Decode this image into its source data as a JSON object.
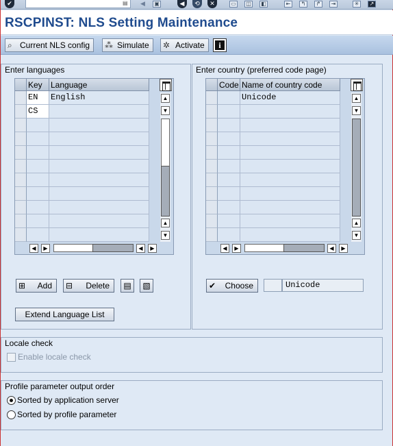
{
  "window": {
    "title": "RSCPINST: NLS Setting Maintenance"
  },
  "system_toolbar": {
    "command_field": {
      "value": "",
      "placeholder": ""
    },
    "icons": [
      "enter-icon",
      "save-icon",
      "back-icon",
      "exit-icon",
      "cancel-icon",
      "print-icon",
      "find-icon",
      "find-next-icon",
      "first-page-icon",
      "prev-page-icon",
      "next-page-icon",
      "last-page-icon",
      "create-session-icon",
      "shortcut-icon"
    ]
  },
  "app_toolbar": {
    "current_nls_config": "Current NLS config",
    "simulate": "Simulate",
    "activate": "Activate",
    "info_icon": "info-icon"
  },
  "languages": {
    "group_title": "Enter languages",
    "columns": [
      "Key",
      "Language"
    ],
    "rows": [
      {
        "key": "EN",
        "language": "English"
      },
      {
        "key": "CS",
        "language": ""
      }
    ],
    "add_label": "Add",
    "delete_label": "Delete",
    "extend_label": "Extend Language List"
  },
  "country": {
    "group_title": "Enter country (preferred code page)",
    "columns": [
      "Code",
      "Name of country code"
    ],
    "rows": [
      {
        "code": "",
        "name": "Unicode"
      }
    ],
    "choose_label": "Choose",
    "selected_code": "",
    "selected_name": "Unicode"
  },
  "locale_check": {
    "group_title": "Locale check",
    "enable_label": "Enable locale check",
    "enabled": false
  },
  "profile_output": {
    "group_title": "Profile parameter output order",
    "options": [
      {
        "label": "Sorted by application server",
        "selected": true
      },
      {
        "label": "Sorted by profile parameter",
        "selected": false
      }
    ]
  },
  "colors": {
    "title_blue": "#1f4b8e",
    "panel_bg": "#dfe9f5",
    "table_bg": "#dbe6f3"
  }
}
